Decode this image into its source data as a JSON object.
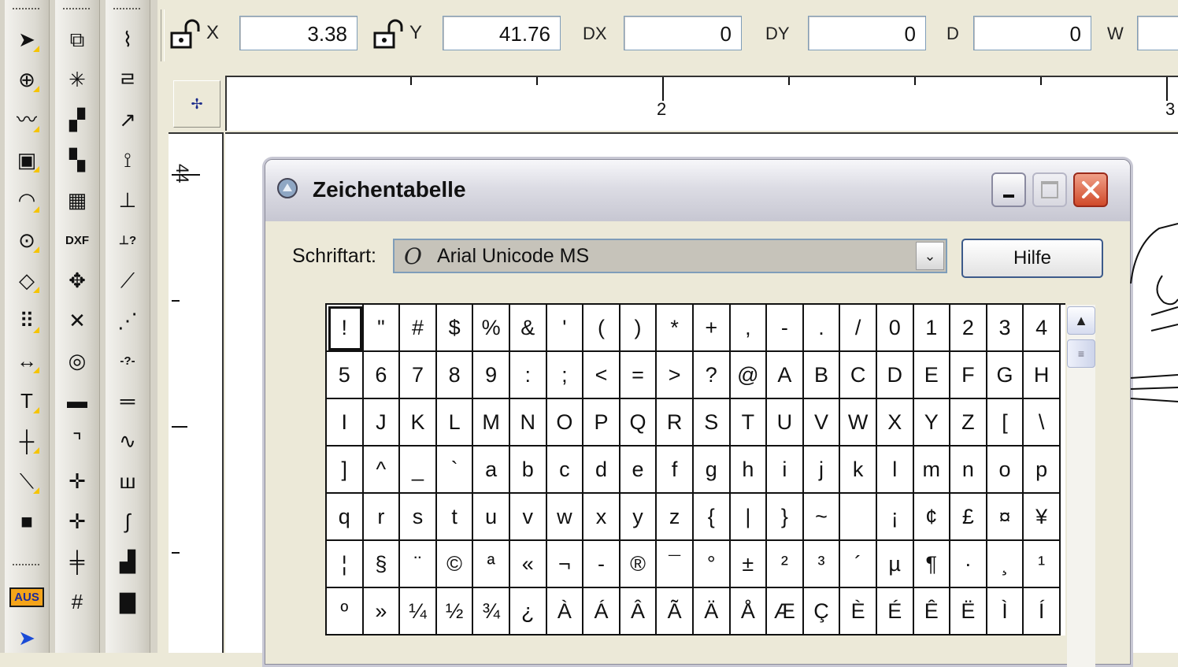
{
  "toolbar_left": {
    "col1": [
      {
        "icon": "arrow-select-icon",
        "glyph": "➤"
      },
      {
        "icon": "zoom-icon",
        "glyph": "⊕"
      },
      {
        "icon": "polyline-icon",
        "glyph": "〰"
      },
      {
        "icon": "cube-icon",
        "glyph": "▣"
      },
      {
        "icon": "arc-icon",
        "glyph": "◠"
      },
      {
        "icon": "circle-icon",
        "glyph": "⊙"
      },
      {
        "icon": "polygon-icon",
        "glyph": "◇"
      },
      {
        "icon": "grid-dots-icon",
        "glyph": "⠿"
      },
      {
        "icon": "dimension-icon",
        "glyph": "↔"
      },
      {
        "icon": "text-icon",
        "glyph": "T"
      },
      {
        "icon": "crosshair-icon",
        "glyph": "┼"
      },
      {
        "icon": "dashed-line-icon",
        "glyph": "⟍"
      },
      {
        "icon": "fill-color-icon",
        "glyph": "■"
      }
    ],
    "col2": [
      {
        "icon": "copy-object-icon",
        "glyph": "⧉"
      },
      {
        "icon": "explode-icon",
        "glyph": "✳"
      },
      {
        "icon": "group-icon",
        "glyph": "▞"
      },
      {
        "icon": "block-icon",
        "glyph": "▚"
      },
      {
        "icon": "import-image-icon",
        "glyph": "▦"
      },
      {
        "icon": "dxf-import-icon",
        "glyph": "DXF"
      },
      {
        "icon": "move-icon",
        "glyph": "✥"
      },
      {
        "icon": "delete-icon",
        "glyph": "✕"
      },
      {
        "icon": "snap-point-icon",
        "glyph": "◎"
      },
      {
        "icon": "hatch-icon",
        "glyph": "▬"
      },
      {
        "icon": "fillet-icon",
        "glyph": "⌝"
      },
      {
        "icon": "cross-magenta-icon",
        "glyph": "✛"
      },
      {
        "icon": "cross-point-icon",
        "glyph": "✛"
      },
      {
        "icon": "parallel-cross-icon",
        "glyph": "╪"
      },
      {
        "icon": "hash-grid-icon",
        "glyph": "#"
      }
    ],
    "col3": [
      {
        "icon": "trend-line-icon",
        "glyph": "⌇"
      },
      {
        "icon": "step-icon",
        "glyph": "ㄹ"
      },
      {
        "icon": "line-arrow-icon",
        "glyph": "↗"
      },
      {
        "icon": "branch-icon",
        "glyph": "⟟"
      },
      {
        "icon": "perpendicular-icon",
        "glyph": "⊥"
      },
      {
        "icon": "perp-query-icon",
        "glyph": "⊥?"
      },
      {
        "icon": "diag-line-icon",
        "glyph": "⟋"
      },
      {
        "icon": "diag-dots-icon",
        "glyph": "⋰"
      },
      {
        "icon": "dim-query-icon",
        "glyph": "-?-"
      },
      {
        "icon": "double-line-icon",
        "glyph": "═"
      },
      {
        "icon": "sine-icon",
        "glyph": "∿"
      },
      {
        "icon": "comb-icon",
        "glyph": "ш"
      },
      {
        "icon": "curve-icon",
        "glyph": "∫"
      },
      {
        "icon": "stairs-icon",
        "glyph": "▟"
      },
      {
        "icon": "block-gray-icon",
        "glyph": "▇"
      }
    ],
    "aus_label": "AUS"
  },
  "coords": {
    "x_label": "X",
    "x_value": "3.38",
    "y_label": "Y",
    "y_value": "41.76",
    "dx_label": "DX",
    "dx_value": "0",
    "dy_label": "DY",
    "dy_value": "0",
    "d_label": "D",
    "d_value": "0",
    "w_label": "W",
    "w_value": ""
  },
  "rulers": {
    "h_label_2": "2",
    "h_label_3": "3",
    "v_label": "44"
  },
  "charmap": {
    "title": "Zeichentabelle",
    "font_label": "Schriftart:",
    "font_value": "Arial Unicode MS",
    "font_icon": "O",
    "help_label": "Hilfe",
    "rows": [
      [
        "!",
        "\"",
        "#",
        "$",
        "%",
        "&",
        "'",
        "(",
        ")",
        "*",
        "+",
        ",",
        "-",
        ".",
        "/",
        "0",
        "1",
        "2",
        "3",
        "4"
      ],
      [
        "5",
        "6",
        "7",
        "8",
        "9",
        ":",
        ";",
        "<",
        "=",
        ">",
        "?",
        "@",
        "A",
        "B",
        "C",
        "D",
        "E",
        "F",
        "G",
        "H"
      ],
      [
        "I",
        "J",
        "K",
        "L",
        "M",
        "N",
        "O",
        "P",
        "Q",
        "R",
        "S",
        "T",
        "U",
        "V",
        "W",
        "X",
        "Y",
        "Z",
        "[",
        "\\"
      ],
      [
        "]",
        "^",
        "_",
        "`",
        "a",
        "b",
        "c",
        "d",
        "e",
        "f",
        "g",
        "h",
        "i",
        "j",
        "k",
        "l",
        "m",
        "n",
        "o",
        "p"
      ],
      [
        "q",
        "r",
        "s",
        "t",
        "u",
        "v",
        "w",
        "x",
        "y",
        "z",
        "{",
        "|",
        "}",
        "~",
        "",
        "¡",
        "¢",
        "£",
        "¤",
        "¥"
      ],
      [
        "¦",
        "§",
        "¨",
        "©",
        "ª",
        "«",
        "¬",
        "-",
        "®",
        "¯",
        "°",
        "±",
        "²",
        "³",
        "´",
        "µ",
        "¶",
        "·",
        "¸",
        "¹"
      ],
      [
        "º",
        "»",
        "¼",
        "½",
        "¾",
        "¿",
        "À",
        "Á",
        "Â",
        "Ã",
        "Ä",
        "Å",
        "Æ",
        "Ç",
        "È",
        "É",
        "Ê",
        "Ë",
        "Ì",
        "Í"
      ]
    ]
  },
  "colors": {
    "toolbar_corner": "#f5c400",
    "aus_bg": "#f4a41a",
    "close_btn": "#d04a2a"
  }
}
